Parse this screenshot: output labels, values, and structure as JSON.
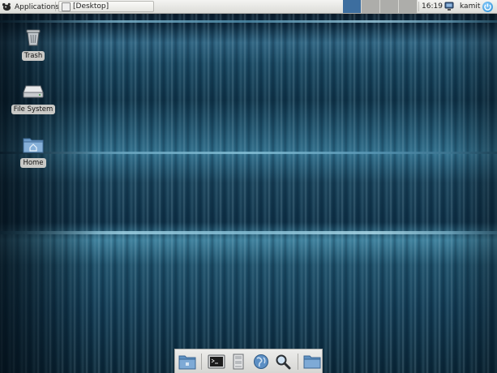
{
  "top_panel": {
    "applications_label": "Applications",
    "task_label": "[Desktop]",
    "workspaces": [
      {
        "active": true
      },
      {
        "active": false
      },
      {
        "active": false
      },
      {
        "active": false
      }
    ],
    "clock": "16:19",
    "username": "kamit"
  },
  "desktop_icons": [
    {
      "label": "Trash",
      "icon": "trash-icon"
    },
    {
      "label": "File System",
      "icon": "drive-icon"
    },
    {
      "label": "Home",
      "icon": "home-folder-icon"
    }
  ],
  "dock": {
    "launchers": [
      {
        "icon": "show-desktop-icon"
      },
      {
        "icon": "terminal-icon"
      },
      {
        "icon": "file-manager-icon"
      },
      {
        "icon": "web-browser-icon"
      },
      {
        "icon": "search-icon"
      },
      {
        "icon": "folder-icon"
      }
    ]
  },
  "colors": {
    "panel_bg": "#e6e6e3",
    "active_workspace": "#3d6e9f",
    "wallpaper_dark": "#0d2a3e",
    "wallpaper_light": "#3a7c98"
  }
}
